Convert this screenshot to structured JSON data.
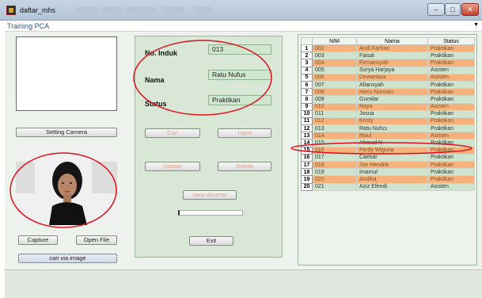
{
  "window": {
    "title": "daftar_mhs",
    "icon": "matlab-figure-icon",
    "controls": [
      "–",
      "□",
      "✕"
    ]
  },
  "menubar": {
    "label": "Training PCA"
  },
  "left": {
    "setting_camera": "Setting Camera",
    "capture": "Capture",
    "open_file": "Open File",
    "cari_via_image": "cari via image"
  },
  "form": {
    "no_induk_label": "No. Induk",
    "no_induk_value": "013",
    "nama_label": "Nama",
    "nama_value": "Ratu Nufus",
    "status_label": "Status",
    "status_value": "Praktikan",
    "cari": "Cari",
    "input": "Input",
    "update": "Update",
    "delete": "Delete",
    "view_absensi": "view absensi",
    "exit": "Exit"
  },
  "table": {
    "columns": [
      "NIM",
      "Nama",
      "Status"
    ],
    "rows": [
      {
        "no": "1",
        "nim": "002",
        "nama": "Andi Farhan",
        "status": "Praktikan"
      },
      {
        "no": "2",
        "nim": "003",
        "nama": "Faisal",
        "status": "Praktikan"
      },
      {
        "no": "3",
        "nim": "004",
        "nama": "Firmansyah",
        "status": "Praktikan"
      },
      {
        "no": "4",
        "nim": "005",
        "nama": "Surya Harjaya",
        "status": "Asisten"
      },
      {
        "no": "5",
        "nim": "006",
        "nama": "Dewantara",
        "status": "Asisten"
      },
      {
        "no": "6",
        "nim": "007",
        "nama": "Afiansyah",
        "status": "Praktikan"
      },
      {
        "no": "7",
        "nim": "008",
        "nama": "Haris Nurman",
        "status": "Praktikan"
      },
      {
        "no": "8",
        "nim": "009",
        "nama": "Gumilar",
        "status": "Praktikan"
      },
      {
        "no": "9",
        "nim": "010",
        "nama": "Raya",
        "status": "Asisten"
      },
      {
        "no": "10",
        "nim": "011",
        "nama": "Josua",
        "status": "Praktikan"
      },
      {
        "no": "11",
        "nim": "012",
        "nama": "Kristy",
        "status": "Praktikan"
      },
      {
        "no": "12",
        "nim": "013",
        "nama": "Ratu Nufus",
        "status": "Praktikan"
      },
      {
        "no": "13",
        "nim": "014",
        "nama": "Maul",
        "status": "Asisten"
      },
      {
        "no": "14",
        "nim": "015",
        "nama": "Ahmad N",
        "status": "Praktikan"
      },
      {
        "no": "15",
        "nim": "016",
        "nama": "Ferdy Wiguna",
        "status": "Praktikan"
      },
      {
        "no": "16",
        "nim": "017",
        "nama": "Caesar",
        "status": "Praktikan"
      },
      {
        "no": "17",
        "nim": "018",
        "nama": "Joe Hendrik",
        "status": "Praktikan"
      },
      {
        "no": "18",
        "nim": "019",
        "nama": "Imamul",
        "status": "Praktikan"
      },
      {
        "no": "19",
        "nim": "020",
        "nama": "Andika",
        "status": "Praktikan"
      },
      {
        "no": "20",
        "nim": "021",
        "nama": "Aziz Efendi",
        "status": "Asisten"
      }
    ]
  },
  "colors": {
    "row_odd": "#f6b27a",
    "row_even": "#cfe4cc",
    "annotation": "#e0101a"
  }
}
